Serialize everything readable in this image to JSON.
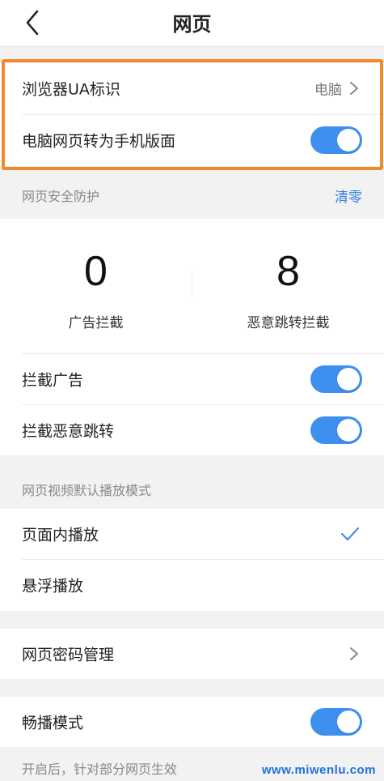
{
  "header": {
    "title": "网页",
    "back_icon": "chevron-left-icon"
  },
  "ua_section": {
    "ua_label": "浏览器UA标识",
    "ua_value": "电脑",
    "mobile_label": "电脑网页转为手机版面",
    "mobile_on": true
  },
  "security": {
    "section_label": "网页安全防护",
    "clear_label": "清零",
    "ad_block_count": "0",
    "ad_block_label": "广告拦截",
    "redirect_block_count": "8",
    "redirect_block_label": "恶意跳转拦截",
    "block_ads_label": "拦截广告",
    "block_ads_on": true,
    "block_redirect_label": "拦截恶意跳转",
    "block_redirect_on": true
  },
  "video": {
    "section_label": "网页视频默认播放模式",
    "inline_label": "页面内播放",
    "inline_selected": true,
    "float_label": "悬浮播放"
  },
  "password": {
    "label": "网页密码管理"
  },
  "smooth": {
    "label": "畅播模式",
    "on": true,
    "note": "开启后，针对部分网页生效"
  },
  "watermark": "www.miwenlu.com",
  "colors": {
    "accent": "#3f8ff0",
    "highlight": "#f08a2c",
    "link": "#2f7fe0"
  }
}
